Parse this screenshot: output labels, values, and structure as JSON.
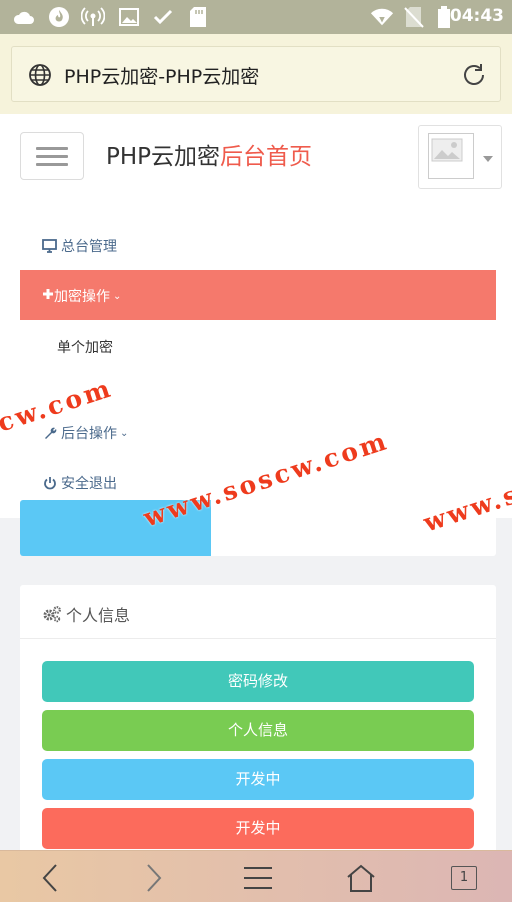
{
  "status_bar": {
    "time": "04:43",
    "icons": [
      "cloud-icon",
      "flame-icon",
      "wifi-hotspot-icon",
      "image-icon",
      "check-icon",
      "sd-card-icon",
      "wifi-icon",
      "no-sim-icon",
      "battery-icon"
    ]
  },
  "browser": {
    "page_title": "PHP云加密-PHP云加密",
    "icons": [
      "globe-icon",
      "reload-icon"
    ]
  },
  "header": {
    "brand_main": "PHP云加密",
    "brand_accent": "后台首页"
  },
  "menu": {
    "items": [
      {
        "label": "总台管理",
        "icon": "monitor-icon"
      },
      {
        "label": "加密操作",
        "icon": "plus-icon",
        "active": true
      },
      {
        "label": "单个加密",
        "icon": ""
      },
      {
        "label": "后台操作",
        "icon": "wrench-icon"
      },
      {
        "label": "安全退出",
        "icon": "power-icon"
      }
    ]
  },
  "personal_info": {
    "title": "个人信息",
    "icon": "gears-icon",
    "buttons": [
      {
        "label": "密码修改",
        "color": "#41c8b9"
      },
      {
        "label": "个人信息",
        "color": "#79cc52"
      },
      {
        "label": "开发中",
        "color": "#5bc8f5"
      },
      {
        "label": "开发中",
        "color": "#fc6b5c"
      }
    ]
  },
  "watermarks": [
    "cw.com",
    "www.soscw.com",
    "www.s"
  ],
  "bottom_nav": {
    "tab_count": "1"
  },
  "colors": {
    "accent_red": "#ef5b4c",
    "menu_active": "#f5796c",
    "watermark": "#ee3b1d"
  }
}
